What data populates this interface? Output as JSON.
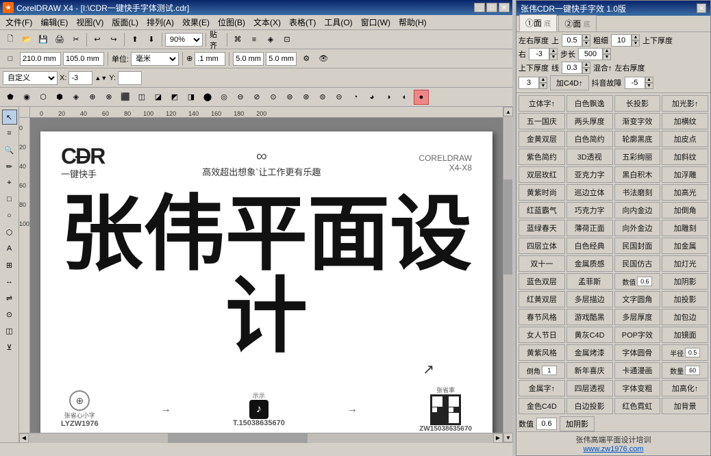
{
  "mainWindow": {
    "title": "CorelDRAW X4 - [I:\\CDR一键快手字体测试.cdr]",
    "icon": "CDR"
  },
  "menuBar": {
    "items": [
      "文件(F)",
      "编辑(E)",
      "视图(V)",
      "版面(L)",
      "排列(A)",
      "效果(E)",
      "位图(B)",
      "文本(X)",
      "表格(T)",
      "工具(O)",
      "窗口(W)",
      "帮助(H)"
    ]
  },
  "toolbar1": {
    "zoom": "90%",
    "align": "贴齐"
  },
  "toolbar2": {
    "width": "210.0 mm",
    "height": "105.0 mm",
    "unit": "毫米",
    "tolerance": ".1 mm",
    "size1": "5.0 mm",
    "size2": "5.0 mm"
  },
  "propBar": {
    "preset": "自定义",
    "x": "-3",
    "y": ""
  },
  "pageContent": {
    "logoText": "CDR",
    "logoSub": "一键快手",
    "headerMiddle": "高效超出想象`让工作更有乐趣",
    "headerInfinity": "∞",
    "headerRight1": "CORELDRAW",
    "headerRight2": "X4-X8",
    "mainText": "张伟平面设计",
    "footer": {
      "left": {
        "icon": "⊕",
        "label1": "张省心小字",
        "label2": "LYZW1976"
      },
      "arrow1": "→",
      "middle": {
        "label": "示示",
        "tiktok": "T.15038635670"
      },
      "arrow2": "→",
      "right": {
        "label": "张省率",
        "phone": "ZW15038635670"
      }
    }
  },
  "statusBar": {
    "text": ""
  },
  "rightPanel": {
    "title": "张伟CDR一键快手字效 1.0版",
    "tabs": {
      "tab1": "①面",
      "tab1sub": "底",
      "tab2": "②面",
      "tab2sub": "底"
    },
    "topControls": {
      "leftWidth": "左右厚度",
      "leftVal": "上",
      "leftNum": "0.5",
      "thinThick": "粗细",
      "thinNum": "10",
      "topBottom": "上下厚度",
      "rightLabel": "右",
      "rightNum": "-3",
      "step": "步长",
      "stepNum": "500",
      "topBottomLabel": "上下厚度",
      "topBottomVal": "线",
      "topBottomNum": "0.3",
      "mix": "混合↑",
      "leftRight": "左右厚度"
    },
    "spinVal1": "3",
    "addC4D": "加C4D↑",
    "shakeLabel": "抖音故障",
    "shakeVal": "-5",
    "effects": [
      [
        "立体字↑",
        "白色飘逸",
        "长投影",
        "加光影↑"
      ],
      [
        "五一国庆",
        "两头厚度",
        "渐变字效",
        "加横纹"
      ],
      [
        "金黄双层",
        "白色简约",
        "轮廓黑底",
        "加皮点"
      ],
      [
        "紫色简约",
        "3D透视",
        "五彩绚丽",
        "加斜纹"
      ],
      [
        "双层玫红",
        "亚克力字",
        "黑白积木",
        "加浮雕"
      ],
      [
        "黄紫时尚",
        "巡边立体",
        "书法磨刻",
        "加高光"
      ],
      [
        "红蓝霸气",
        "巧克力字",
        "向内金边",
        "加倒角"
      ],
      [
        "蓝绿春天",
        "薄荷正面",
        "向外金边",
        "加雕刻"
      ],
      [
        "四层立体",
        "白色经典",
        "民国封面",
        "加金属"
      ],
      [
        "双十一",
        "金属质感",
        "民国仿古",
        "加灯光"
      ],
      [
        "蓝色双层",
        "孟菲斯",
        "数值",
        "加阴影"
      ],
      [
        "红黄双层",
        "多层描边",
        "文字圆角",
        "加投影"
      ],
      [
        "春节风格",
        "游戏酷黑",
        "多层厚度",
        "加包边"
      ],
      [
        "女人节日",
        "黄灰C4D",
        "POP字效",
        "加镜面"
      ],
      [
        "黄紫风格",
        "金属烤漆",
        "字体圆骨",
        "半径"
      ],
      [
        "倒角",
        "新年喜庆",
        "卡通漫画",
        "数量"
      ],
      [
        "金属字↑",
        "四层透视",
        "字体变粗",
        "加高化↑"
      ],
      [
        "金色C4D",
        "白边投影",
        "红色霓虹",
        "加背景"
      ]
    ],
    "shakeNumVal": "0.6",
    "radiusVal": "0.5",
    "cornerVal": "1",
    "quantityVal": "60",
    "brand": "张伟高端平面设计培训",
    "website": "www.zw1976.com"
  }
}
